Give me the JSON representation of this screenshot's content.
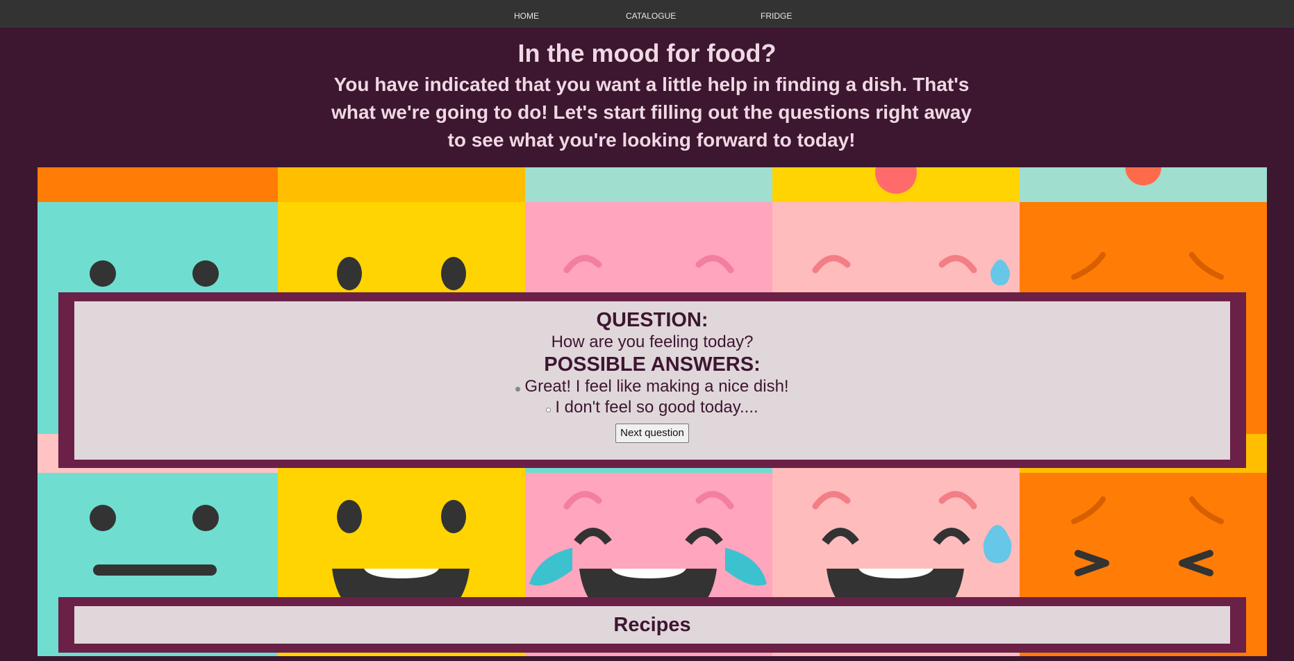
{
  "nav": {
    "items": [
      {
        "label": "HOME"
      },
      {
        "label": "CATALOGUE"
      },
      {
        "label": "FRIDGE"
      }
    ]
  },
  "hero": {
    "title": "In the mood for food?",
    "text": "You have indicated that you want a little help in finding a dish. That's what we're going to do! Let's start filling out the questions right away to see what you're looking forward to today!"
  },
  "question_panel": {
    "question_heading": "QUESTION:",
    "question_text": "How are you feeling today?",
    "answers_heading": "POSSIBLE ANSWERS:",
    "answers": [
      {
        "label": "Great! I feel like making a nice dish!",
        "selected": true
      },
      {
        "label": "I don't feel so good today....",
        "selected": false
      }
    ],
    "next_button_label": "Next question"
  },
  "recipes_panel": {
    "title": "Recipes"
  },
  "colors": {
    "page_background": "#3d1630",
    "navbar": "#333333",
    "panel_border": "#6b2047",
    "panel_fill": "#e0d7db",
    "heading_text": "#efd9e3"
  }
}
